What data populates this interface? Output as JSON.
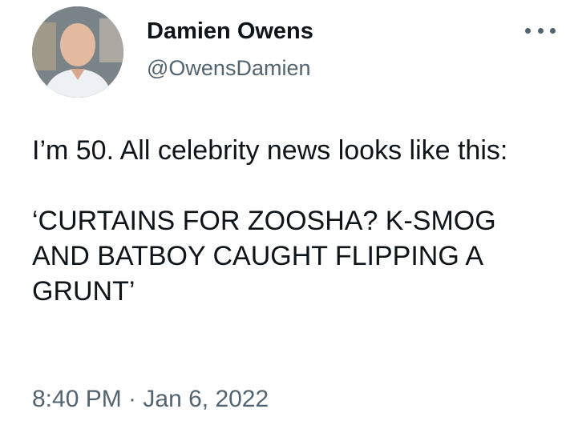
{
  "author": {
    "display_name": "Damien Owens",
    "handle": "@OwensDamien",
    "avatar_icon": "profile-photo"
  },
  "tweet": {
    "text_line1": "I’m 50. All celebrity news looks like this:",
    "text_line2": "‘CURTAINS FOR ZOOSHA? K-SMOG AND BATBOY CAUGHT FLIPPING A GRUNT’",
    "timestamp": "8:40 PM · Jan 6, 2022"
  },
  "actions": {
    "more_icon": "more-horizontal-icon"
  },
  "colors": {
    "text_primary": "#0f1419",
    "text_secondary": "#536471",
    "background": "#ffffff"
  }
}
